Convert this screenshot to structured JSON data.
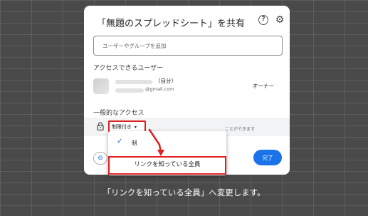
{
  "dialog": {
    "title": "「無題のスプレッドシート」を共有",
    "help_icon": "?",
    "gear_icon": "⚙",
    "search_placeholder": "ユーザーやグループを追加",
    "access_section": "アクセスできるユーザー",
    "user": {
      "name": "（自分）",
      "email": "@gmail.com",
      "role": "オーナー"
    },
    "general_section": "一般的なアクセス",
    "restriction": "制限付き",
    "restriction_arrow": "▾",
    "general_desc": "ことができます",
    "link_icon": "⊖",
    "done_label": "完了"
  },
  "menu": {
    "check": "✓",
    "item_restricted": "制",
    "item_anyone": "リンクを知っている全員"
  },
  "caption": "「リンクを知っている全員」へ変更します。",
  "colors": {
    "accent": "#1a73e8",
    "highlight": "#e02020",
    "overlay": "#4a4a4a"
  }
}
